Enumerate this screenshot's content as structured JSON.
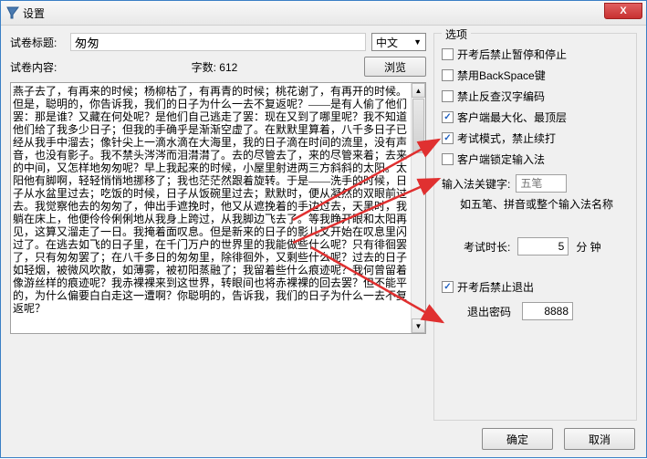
{
  "window": {
    "title": "设置",
    "close": "X"
  },
  "left": {
    "title_label": "试卷标题:",
    "title_value": "匆匆",
    "lang_value": "中文",
    "content_label": "试卷内容:",
    "charcount_label": "字数: 612",
    "browse_label": "浏览",
    "body_text": "燕子去了，有再来的时候；杨柳枯了，有再青的时候；桃花谢了，有再开的时候。但是，聪明的，你告诉我，我们的日子为什么一去不复返呢？——是有人偷了他们罢：那是谁？又藏在何处呢？是他们自己逃走了罢：现在又到了哪里呢？我不知道他们给了我多少日子；但我的手确乎是渐渐空虚了。在默默里算着，八千多日子已经从我手中溜去；像针尖上一滴水滴在大海里，我的日子滴在时间的流里，没有声音，也没有影子。我不禁头涔涔而泪潸潸了。去的尽管去了，来的尽管来着；去来的中间，又怎样地匆匆呢？早上我起来的时候，小屋里射进两三方斜斜的太阳。太阳他有脚啊，轻轻悄悄地挪移了；我也茫茫然跟着旋转。于是——洗手的时候，日子从水盆里过去；吃饭的时候，日子从饭碗里过去；默默时，便从凝然的双眼前过去。我觉察他去的匆匆了，伸出手遮挽时，他又从遮挽着的手边过去，天黑时，我躺在床上，他便伶伶俐俐地从我身上跨过，从我脚边飞去了。等我睁开眼和太阳再见，这算又溜走了一日。我掩着面叹息。但是新来的日子的影儿又开始在叹息里闪过了。在逃去如飞的日子里，在千门万户的世界里的我能做些什么呢？只有徘徊罢了，只有匆匆罢了；在八千多日的匆匆里，除徘徊外，又剩些什么呢？过去的日子如轻烟，被微风吹散，如薄雾，被初阳蒸融了；我留着些什么痕迹呢？我何曾留着像游丝样的痕迹呢？我赤裸裸来到这世界，转眼间也将赤裸裸的回去罢？但不能平的，为什么偏要白白走这一遭啊？你聪明的，告诉我，我们的日子为什么一去不复返呢？"
  },
  "options": {
    "group_label": "选项",
    "chk1": {
      "label": "开考后禁止暂停和停止",
      "checked": false
    },
    "chk2": {
      "label": "禁用BackSpace键",
      "checked": false
    },
    "chk3": {
      "label": "禁止反查汉字编码",
      "checked": false
    },
    "chk4": {
      "label": "客户端最大化、最顶层",
      "checked": true
    },
    "chk5": {
      "label": "考试模式，禁止续打",
      "checked": true
    },
    "chk6": {
      "label": "客户端锁定输入法",
      "checked": false
    },
    "keyword_label": "输入法关键字:",
    "keyword_placeholder": "五笔",
    "keyword_hint": "如五笔、拼音或整个输入法名称",
    "duration_label": "考试时长:",
    "duration_value": "5",
    "duration_unit": "分 钟",
    "exit_chk": {
      "label": "开考后禁止退出",
      "checked": true
    },
    "exit_pwd_label": "退出密码",
    "exit_pwd_value": "8888"
  },
  "footer": {
    "ok": "确定",
    "cancel": "取消"
  }
}
